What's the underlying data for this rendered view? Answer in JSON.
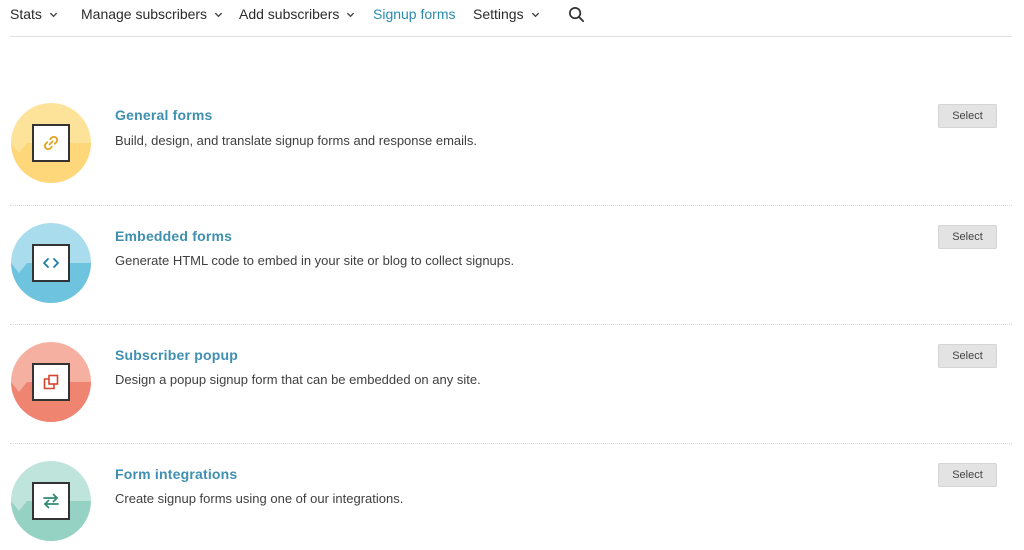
{
  "nav": {
    "items": [
      {
        "label": "Stats",
        "has_dropdown": true
      },
      {
        "label": "Manage subscribers",
        "has_dropdown": true
      },
      {
        "label": "Add subscribers",
        "has_dropdown": true
      },
      {
        "label": "Signup forms",
        "has_dropdown": false,
        "active": true
      },
      {
        "label": "Settings",
        "has_dropdown": true
      }
    ],
    "search_icon": "search-icon",
    "active_color": "#2a8bb0"
  },
  "forms": [
    {
      "title": "General forms",
      "description": "Build, design, and translate signup forms and response emails.",
      "button": "Select",
      "icon": "link-icon",
      "color_top": "#fde39a",
      "color_bottom": "#fdd779",
      "icon_color": "#e2a21c"
    },
    {
      "title": "Embedded forms",
      "description": "Generate HTML code to embed in your site or blog to collect signups.",
      "button": "Select",
      "icon": "code-icon",
      "color_top": "#a9dcec",
      "color_bottom": "#6ec3de",
      "icon_color": "#1e7fa3"
    },
    {
      "title": "Subscriber popup",
      "description": "Design a popup signup form that can be embedded on any site.",
      "button": "Select",
      "icon": "popup-icon",
      "color_top": "#f6b0a2",
      "color_bottom": "#ef8571",
      "icon_color": "#d6452e"
    },
    {
      "title": "Form integrations",
      "description": "Create signup forms using one of our integrations.",
      "button": "Select",
      "icon": "swap-arrows-icon",
      "color_top": "#bfe4db",
      "color_bottom": "#96d2c4",
      "icon_color": "#2f8a74"
    }
  ]
}
